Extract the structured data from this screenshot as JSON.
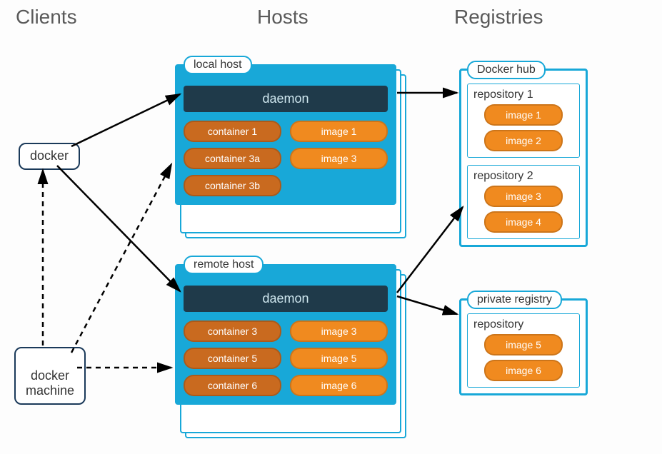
{
  "columns": {
    "clients": "Clients",
    "hosts": "Hosts",
    "registries": "Registries"
  },
  "clients": {
    "docker": "docker",
    "docker_machine": "docker\nmachine"
  },
  "hosts": {
    "local": {
      "label": "local host",
      "daemon": "daemon",
      "rows": [
        {
          "container": "container 1",
          "image": "image 1"
        },
        {
          "container": "container 3a",
          "image": "image 3"
        },
        {
          "container": "container 3b",
          "image": null
        }
      ]
    },
    "remote": {
      "label": "remote host",
      "daemon": "daemon",
      "rows": [
        {
          "container": "container 3",
          "image": "image 3"
        },
        {
          "container": "container 5",
          "image": "image 5"
        },
        {
          "container": "container 6",
          "image": "image 6"
        }
      ]
    }
  },
  "registries": {
    "docker_hub": {
      "label": "Docker hub",
      "repos": [
        {
          "title": "repository 1",
          "images": [
            "image 1",
            "image 2"
          ]
        },
        {
          "title": "repository 2",
          "images": [
            "image 3",
            "image 4"
          ]
        }
      ]
    },
    "private": {
      "label": "private registry",
      "repos": [
        {
          "title": "repository",
          "images": [
            "image 5",
            "image 6"
          ]
        }
      ]
    }
  }
}
